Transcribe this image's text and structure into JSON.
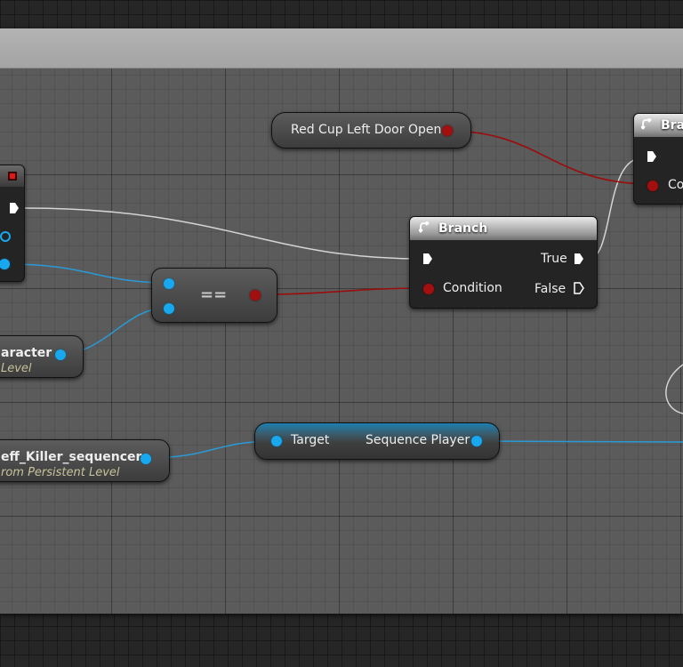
{
  "nodes": {
    "red_cup": {
      "label": "Red Cup Left Door Open"
    },
    "branch": {
      "title": "Branch",
      "true_label": "True",
      "condition_label": "Condition",
      "false_label": "False"
    },
    "equal": {
      "label": "=="
    },
    "branch_right": {
      "title": "Bra",
      "condition_label": "Co"
    },
    "character_ref": {
      "title": "aracter",
      "subtitle": "Level"
    },
    "sequencer_ref": {
      "title": "eff_Killer_sequencer",
      "subtitle": "rom Persistent Level"
    },
    "sequence_player": {
      "target_label": "Target",
      "output_label": "Sequence Player"
    }
  },
  "colors": {
    "object_pin": "#18a8f0",
    "bool_pin": "#a30f0f",
    "exec_wire": "#d9d9d9",
    "event_accent": "#d02020"
  },
  "icons": {
    "branch_icon": "branch-arrow-icon",
    "exec_pin": "exec-arrow-icon"
  }
}
